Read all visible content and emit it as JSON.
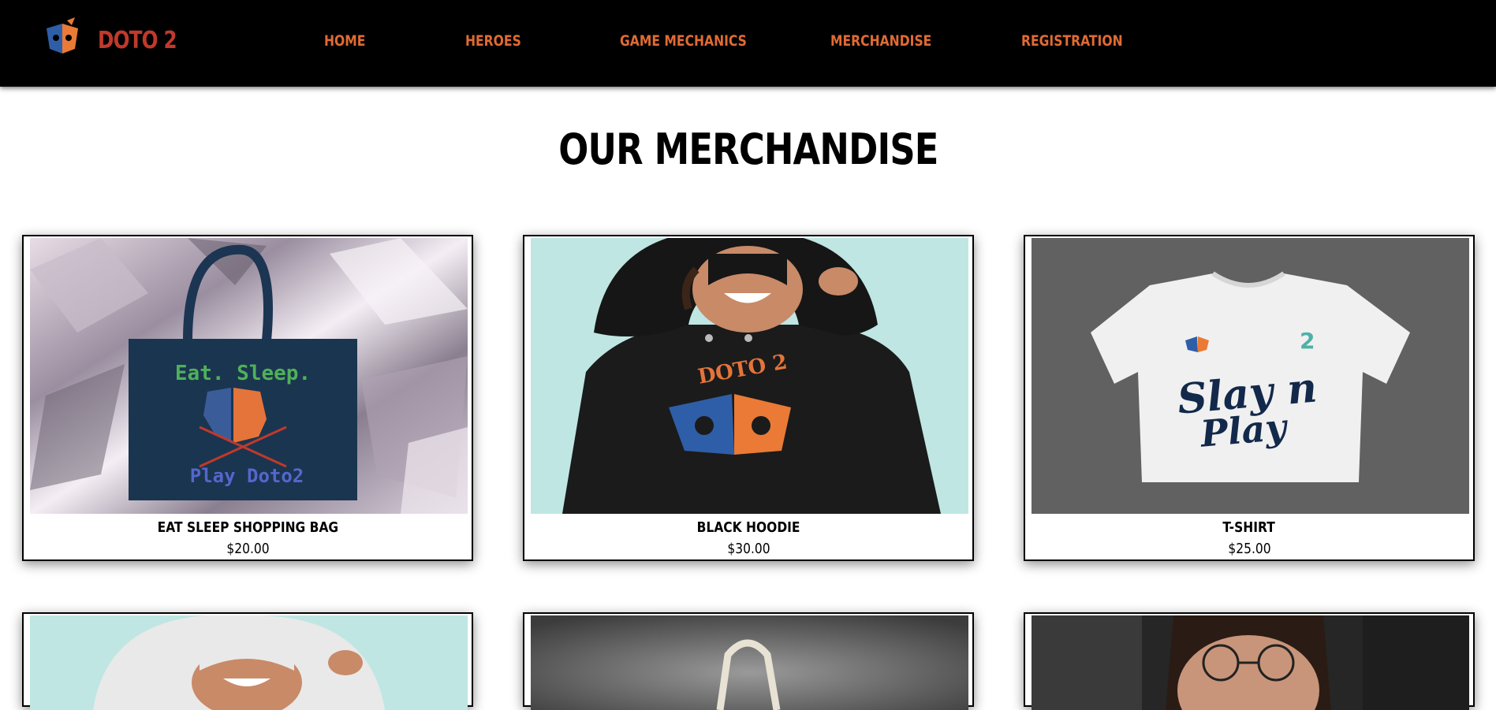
{
  "header": {
    "brand": "DOTO 2",
    "nav": [
      {
        "label": "HOME"
      },
      {
        "label": "HEROES"
      },
      {
        "label": "GAME MECHANICS"
      },
      {
        "label": "MERCHANDISE"
      },
      {
        "label": "REGISTRATION"
      }
    ]
  },
  "page": {
    "title": "OUR MERCHANDISE"
  },
  "products": [
    {
      "name": "EAT SLEEP SHOPPING BAG",
      "price": "$20.00",
      "print_top": "Eat. Sleep.",
      "print_bottom": "Play Doto2"
    },
    {
      "name": "BLACK HOODIE",
      "price": "$30.00",
      "print": "DOTO 2"
    },
    {
      "name": "T-SHIRT",
      "price": "$25.00",
      "print_line1": "Slay n",
      "print_line2": "Play",
      "print_brand": "2"
    }
  ],
  "colors": {
    "header_bg": "#000000",
    "brand": "#c0392b",
    "nav": "#e06b33",
    "logo_orange": "#ea7a35",
    "logo_blue": "#2f5ea8"
  }
}
